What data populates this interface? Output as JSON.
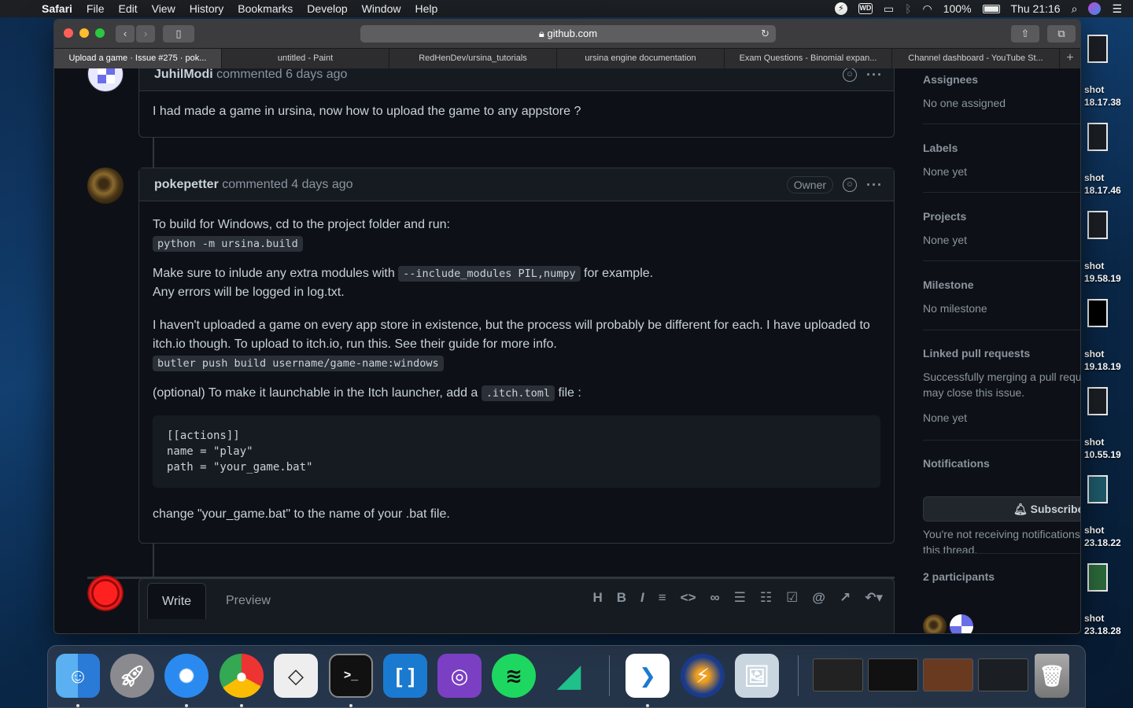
{
  "menubar": {
    "app": "Safari",
    "items": [
      "File",
      "Edit",
      "View",
      "History",
      "Bookmarks",
      "Develop",
      "Window",
      "Help"
    ],
    "battery": "100%",
    "clock": "Thu 21:16",
    "wd_label": "WD"
  },
  "browser": {
    "url": "github.com",
    "tabs": [
      "Upload a game · Issue #275 · pok...",
      "untitled - Paint",
      "RedHenDev/ursina_tutorials",
      "ursina engine documentation",
      "Exam Questions - Binomial expan...",
      "Channel dashboard - YouTube St..."
    ]
  },
  "comments": [
    {
      "author": "JuhilModi",
      "meta": "commented 6 days ago",
      "body": "I had made a game in ursina, now how to upload the game to any appstore ?"
    },
    {
      "author": "pokepetter",
      "meta": "commented 4 days ago",
      "badge": "Owner",
      "p1": "To build for Windows, cd to the project folder and run:",
      "code1": "python -m ursina.build",
      "p2a": "Make sure to inlude any extra modules with ",
      "code2": "--include_modules PIL,numpy",
      "p2b": " for example.",
      "p2c": "Any errors will be logged in log.txt.",
      "p3": "I haven't uploaded a game on every app store in existence, but the process will probably be different for each. I have uploaded to itch.io though. To upload to itch.io, run this. See their guide for more info.",
      "code3": "butler push build username/game-name:windows",
      "p4a": "(optional) To make it launchable in the Itch launcher, add a ",
      "code4": ".itch.toml",
      "p4b": " file :",
      "codeblock": "[[actions]]\nname = \"play\"\npath = \"your_game.bat\"",
      "p5": "change \"your_game.bat\" to the name of your .bat file."
    }
  ],
  "editor": {
    "write_tab": "Write",
    "preview_tab": "Preview"
  },
  "sidebar": {
    "assignees_title": "Assignees",
    "assignees_value": "No one assigned",
    "labels_title": "Labels",
    "labels_value": "None yet",
    "projects_title": "Projects",
    "projects_value": "None yet",
    "milestone_title": "Milestone",
    "milestone_value": "No milestone",
    "linked_title": "Linked pull requests",
    "linked_text": "Successfully merging a pull request may close this issue.",
    "linked_value": "None yet",
    "notifications_title": "Notifications",
    "subscribe_label": "Subscribe",
    "notif_text": "You're not receiving notifications from this thread.",
    "participants_title": "2 participants"
  },
  "desktop_files": [
    {
      "line1": "shot",
      "line2": "18.17.38"
    },
    {
      "line1": "shot",
      "line2": "18.17.46"
    },
    {
      "line1": "shot",
      "line2": "19.58.19"
    },
    {
      "line1": "shot",
      "line2": "19.18.19"
    },
    {
      "line1": "shot",
      "line2": "10.55.19"
    },
    {
      "line1": "shot",
      "line2": "23.18.22"
    },
    {
      "line1": "shot",
      "line2": "23.18.28"
    }
  ]
}
